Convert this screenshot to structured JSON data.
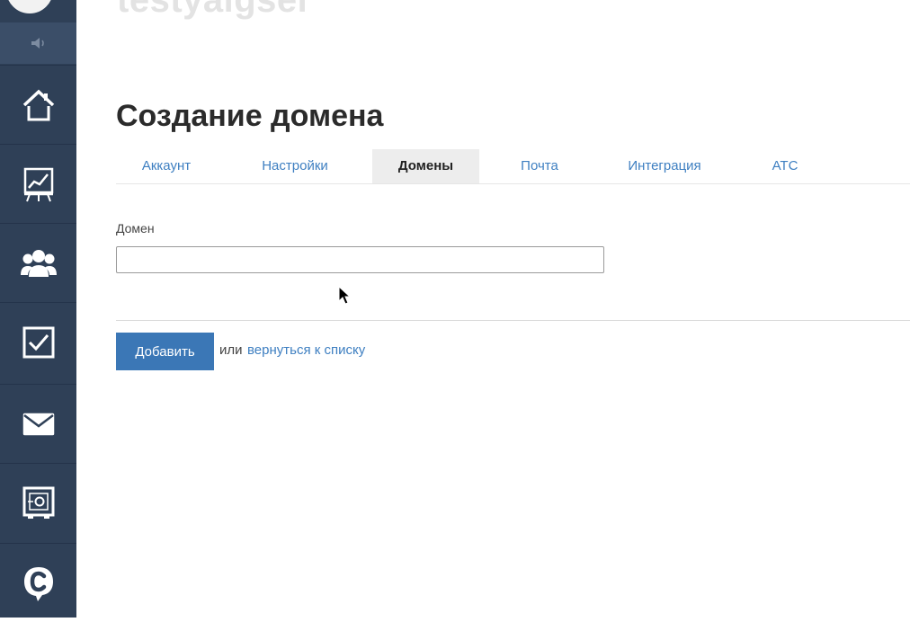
{
  "app": {
    "name": "testyalgsel"
  },
  "page": {
    "title": "Создание домена"
  },
  "tabs": [
    {
      "label": "Аккаунт",
      "active": false
    },
    {
      "label": "Настройки",
      "active": false
    },
    {
      "label": "Домены",
      "active": true
    },
    {
      "label": "Почта",
      "active": false
    },
    {
      "label": "Интеграция",
      "active": false
    },
    {
      "label": "АТС",
      "active": false
    }
  ],
  "form": {
    "domain_label": "Домен",
    "domain_value": "",
    "submit_label": "Добавить",
    "or_text": "или",
    "back_link": "вернуться к списку"
  },
  "sidebar": {
    "items": [
      {
        "icon": "sound-icon"
      },
      {
        "icon": "home-icon"
      },
      {
        "icon": "chart-icon"
      },
      {
        "icon": "users-icon"
      },
      {
        "icon": "checkbox-icon"
      },
      {
        "icon": "mail-icon"
      },
      {
        "icon": "safe-icon"
      },
      {
        "icon": "chat-c-icon"
      }
    ]
  },
  "colors": {
    "sidebar_bg": "#2f4057",
    "accent": "#3b77b6",
    "link": "#3e7fc1"
  }
}
